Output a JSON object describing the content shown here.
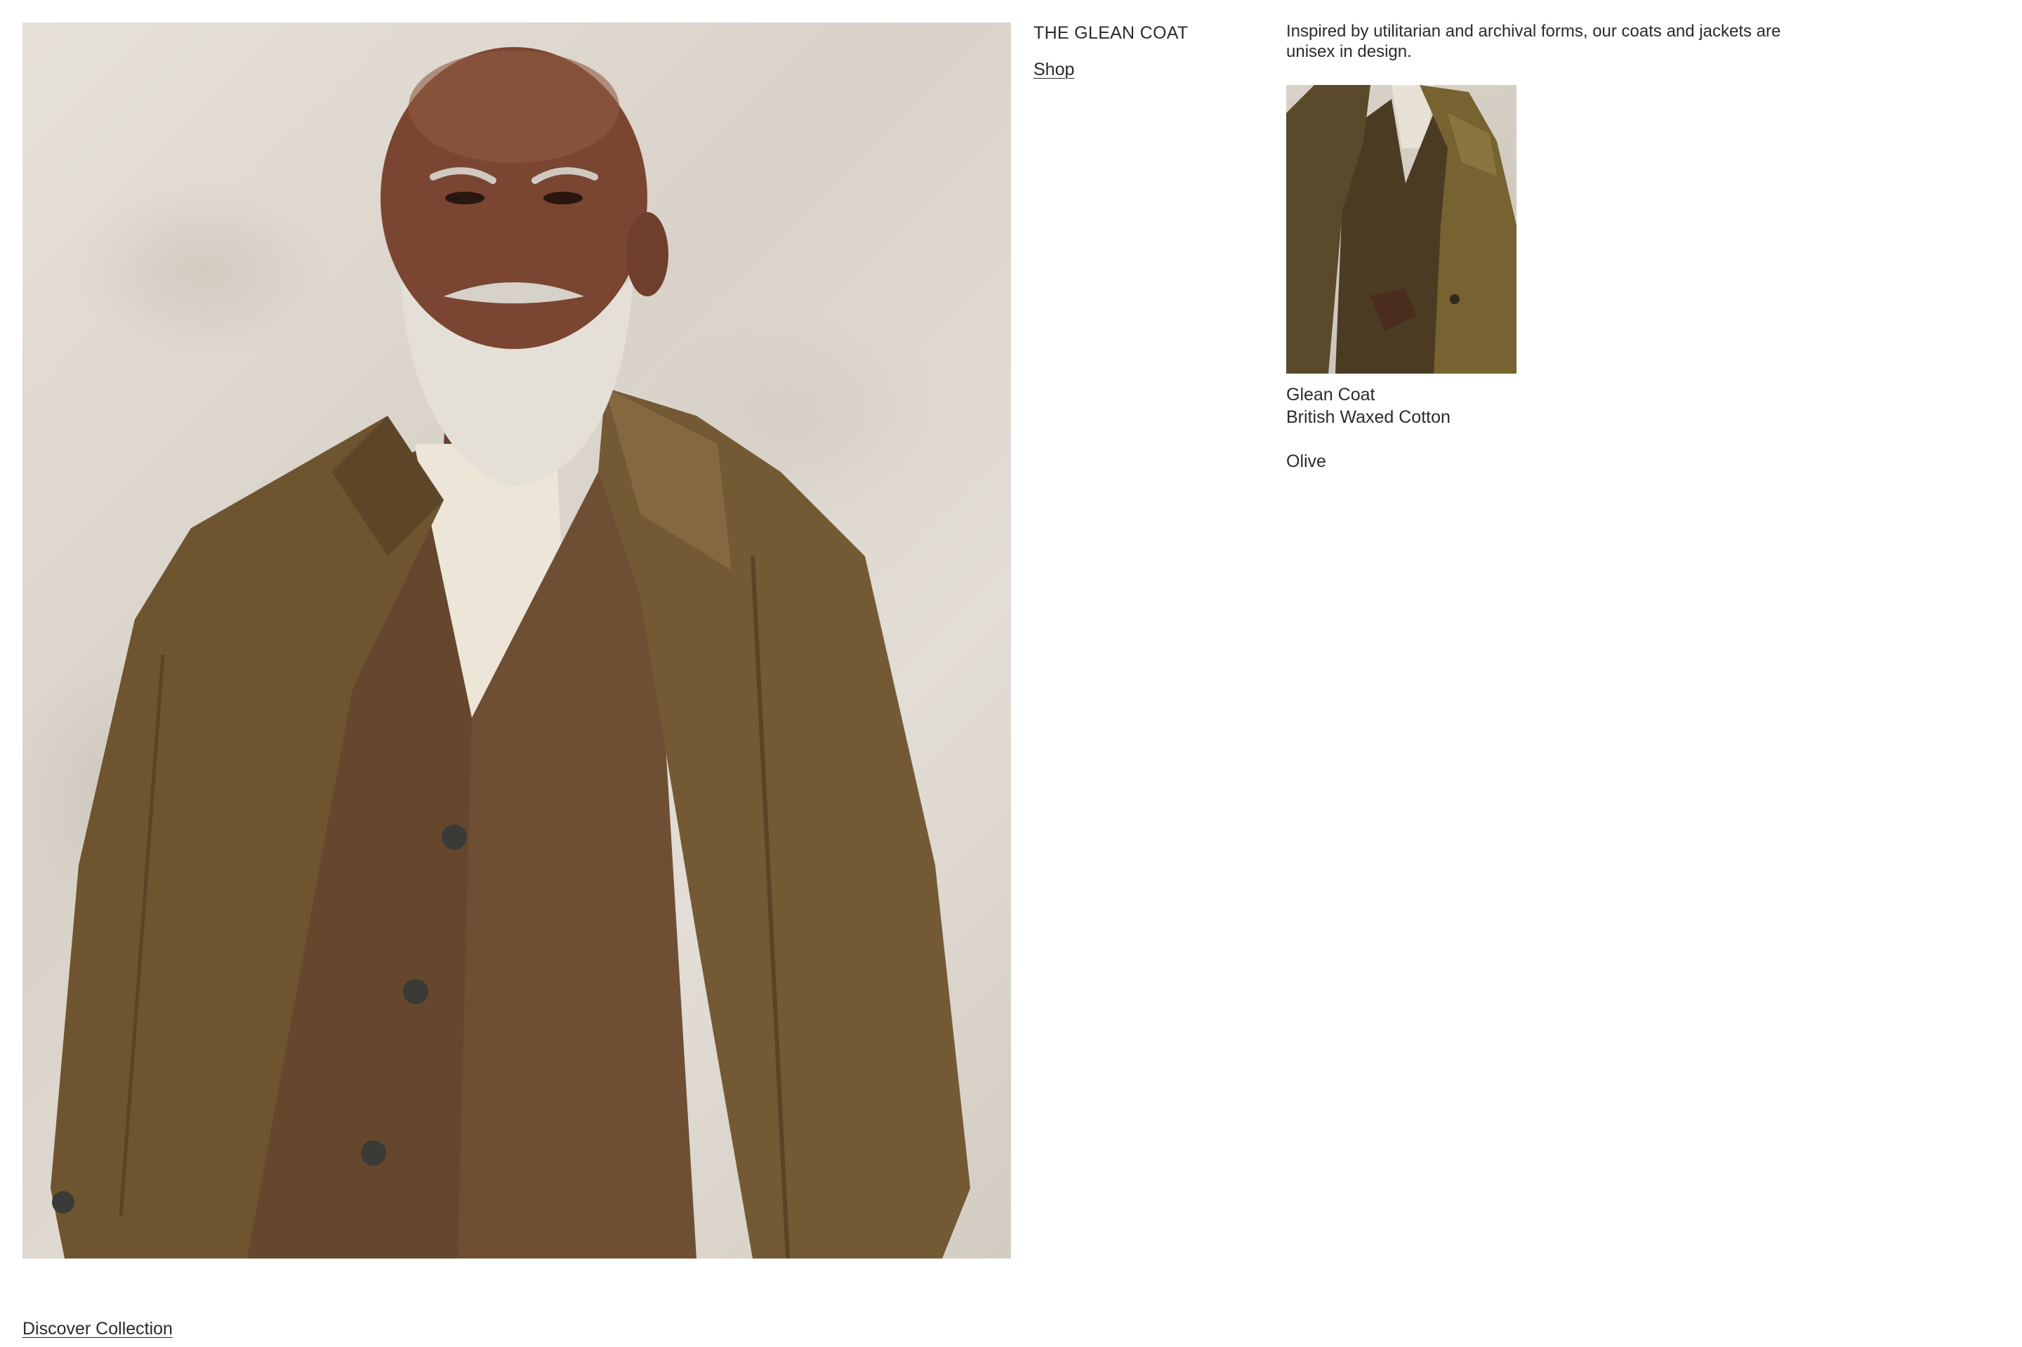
{
  "feature": {
    "title": "THE GLEAN COAT",
    "shop_label": "Shop",
    "description": "Inspired by utilitarian and archival forms, our coats and jackets are unisex in design."
  },
  "product": {
    "name": "Glean Coat",
    "material": "British Waxed Cotton",
    "color": "Olive"
  },
  "footer": {
    "discover_label": "Discover Collection"
  },
  "colors": {
    "text": "#2b2b2b",
    "background": "#ffffff",
    "coat_olive": "#6e5530",
    "backdrop_plaster": "#e2ddd6"
  }
}
